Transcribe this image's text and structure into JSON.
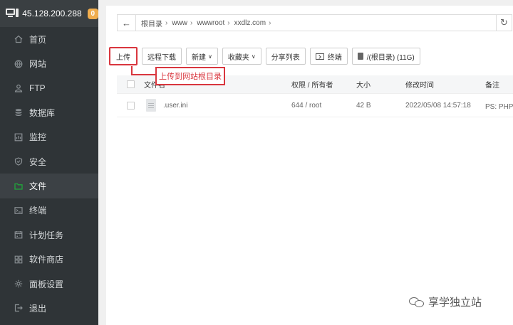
{
  "sidebar": {
    "server_ip": "45.128.200.288",
    "badge_count": "0",
    "items": [
      {
        "label": "首页",
        "icon": "home-icon"
      },
      {
        "label": "网站",
        "icon": "globe-icon"
      },
      {
        "label": "FTP",
        "icon": "user-icon"
      },
      {
        "label": "数据库",
        "icon": "database-icon"
      },
      {
        "label": "监控",
        "icon": "monitor-icon"
      },
      {
        "label": "安全",
        "icon": "shield-icon"
      },
      {
        "label": "文件",
        "icon": "folder-icon",
        "active": true
      },
      {
        "label": "终端",
        "icon": "terminal-icon"
      },
      {
        "label": "计划任务",
        "icon": "calendar-icon"
      },
      {
        "label": "软件商店",
        "icon": "grid-icon"
      },
      {
        "label": "面板设置",
        "icon": "gear-icon"
      },
      {
        "label": "退出",
        "icon": "logout-icon"
      }
    ],
    "accent_color": "#20a53a"
  },
  "path": {
    "crumbs": [
      "根目录",
      "www",
      "wwwroot",
      "xxdlz.com"
    ]
  },
  "toolbar": {
    "upload": "上传",
    "remote_download": "远程下载",
    "new": "新建",
    "favorites": "收藏夹",
    "share_list": "分享列表",
    "terminal": "终端",
    "disk": "/(根目录) (11G)"
  },
  "callout": {
    "text": "上传到网站根目录",
    "color": "#d9363e"
  },
  "table": {
    "headers": {
      "name": "文件名",
      "perm": "权限 / 所有者",
      "size": "大小",
      "time": "修改时间",
      "note": "备注"
    },
    "rows": [
      {
        "name": ".user.ini",
        "perm": "644 / root",
        "size": "42 B",
        "time": "2022/05/08 14:57:18",
        "note": "PS: PHP用"
      }
    ]
  },
  "watermark": {
    "text": "享学独立站"
  }
}
